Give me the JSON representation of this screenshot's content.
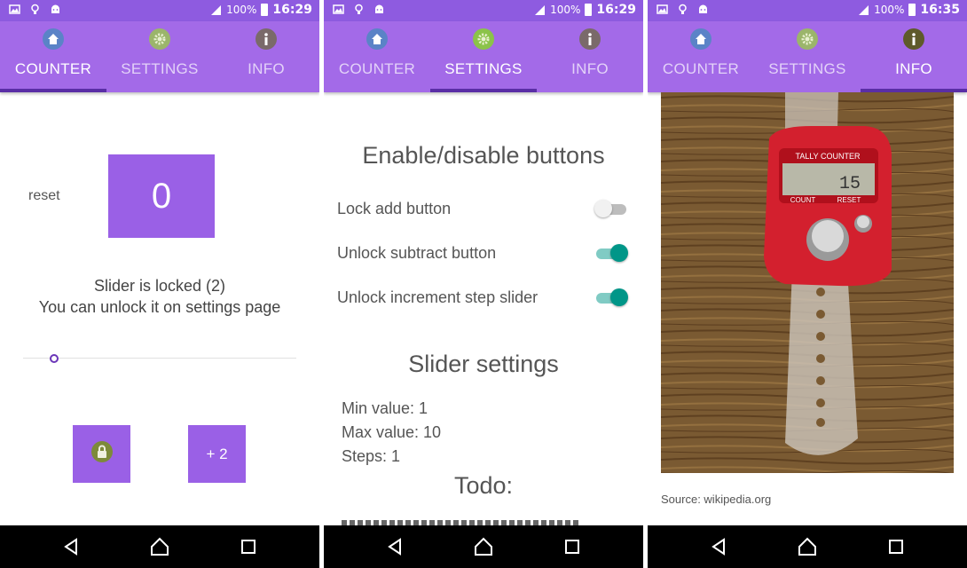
{
  "colors": {
    "statusbar": "#8e5be0",
    "toolbar": "#a36ae8",
    "accent": "#9a60e6",
    "switch_on": "#009688"
  },
  "screens": [
    {
      "status": {
        "battery": "100%",
        "time": "16:29"
      },
      "tabs": [
        {
          "label": "COUNTER",
          "icon": "home-icon"
        },
        {
          "label": "SETTINGS",
          "icon": "gear-icon"
        },
        {
          "label": "INFO",
          "icon": "info-icon"
        }
      ],
      "active_tab": 0
    },
    {
      "status": {
        "battery": "100%",
        "time": "16:29"
      },
      "tabs": [
        {
          "label": "COUNTER",
          "icon": "home-icon"
        },
        {
          "label": "SETTINGS",
          "icon": "gear-icon"
        },
        {
          "label": "INFO",
          "icon": "info-icon"
        }
      ],
      "active_tab": 1
    },
    {
      "status": {
        "battery": "100%",
        "time": "16:35"
      },
      "tabs": [
        {
          "label": "COUNTER",
          "icon": "home-icon"
        },
        {
          "label": "SETTINGS",
          "icon": "gear-icon"
        },
        {
          "label": "INFO",
          "icon": "info-icon"
        }
      ],
      "active_tab": 2
    }
  ],
  "counter": {
    "reset_label": "reset",
    "count": "0",
    "slider_message_1": "Slider is locked (2)",
    "slider_message_2": "You can unlock it on settings page",
    "slider_value": 1,
    "add_label": "+ 2",
    "lock_icon": "lock-icon"
  },
  "settings": {
    "heading_buttons": "Enable/disable buttons",
    "switches": [
      {
        "label": "Lock add button",
        "on": false
      },
      {
        "label": "Unlock subtract button",
        "on": true
      },
      {
        "label": "Unlock increment step slider",
        "on": true
      }
    ],
    "heading_slider": "Slider settings",
    "min_value": "Min value: 1",
    "max_value": "Max value: 10",
    "steps": "Steps: 1",
    "heading_todo": "Todo:"
  },
  "info": {
    "image": "tally-counter-photo",
    "image_text_top": "TALLY COUNTER",
    "image_display": "15",
    "image_text_count": "COUNT",
    "image_text_reset": "RESET",
    "source": "Source: wikipedia.org"
  }
}
